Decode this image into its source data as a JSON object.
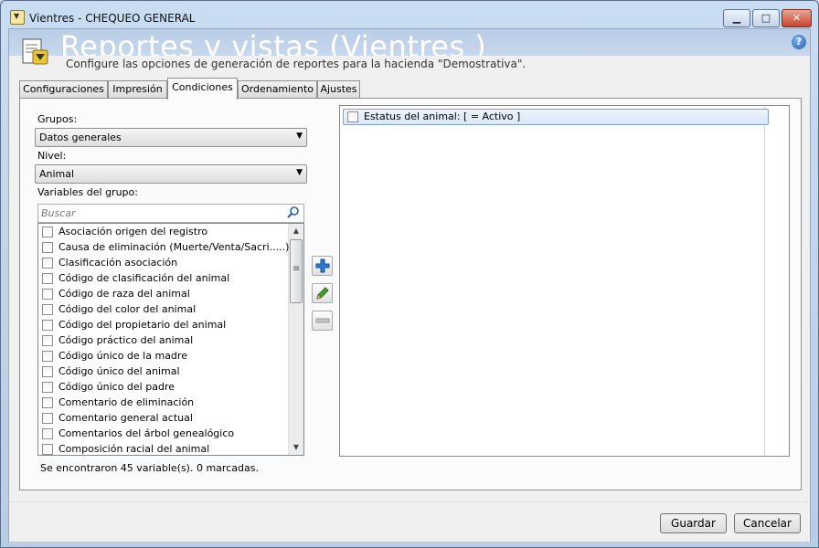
{
  "window": {
    "title": "Vientres  - CHEQUEO GENERAL"
  },
  "header": {
    "title": "Reportes y vistas (Vientres )",
    "subtitle": "Configure las opciones de generación de reportes para la hacienda \"Demostrativa\".",
    "help_glyph": "?"
  },
  "tabs": [
    {
      "label": "Configuraciones"
    },
    {
      "label": "Impresión"
    },
    {
      "label": "Condiciones"
    },
    {
      "label": "Ordenamiento"
    },
    {
      "label": "Ajustes"
    }
  ],
  "left_panel": {
    "grupos_label": "Grupos:",
    "grupos_value": "Datos generales",
    "nivel_label": "Nivel:",
    "nivel_value": "Animal",
    "variables_label": "Variables del grupo:",
    "search_placeholder": "Buscar",
    "variables": [
      "Asociación origen del registro",
      "Causa de eliminación (Muerte/Venta/Sacri.....)",
      "Clasificación asociación",
      "Código de clasificación del animal",
      "Código de raza del animal",
      "Código del color del animal",
      "Código del propietario del animal",
      "Código práctico del animal",
      "Código único de la madre",
      "Código único del animal",
      "Código único del padre",
      "Comentario de eliminación",
      "Comentario general actual",
      "Comentarios del árbol genealógico",
      "Composición racial del animal"
    ],
    "count_text": "Se encontraron 45 variable(s). 0 marcadas."
  },
  "conditions": [
    {
      "label": "Estatus del animal: [ = Activo ]"
    }
  ],
  "footer": {
    "save_label": "Guardar",
    "cancel_label": "Cancelar"
  },
  "icons": {
    "add": "plus-icon",
    "edit": "pencil-icon",
    "remove": "minus-icon",
    "search": "search-icon",
    "help": "help-icon",
    "app": "app-icon",
    "report": "report-icon"
  },
  "colors": {
    "titlebar": "#c9dcf2",
    "selection": "#d9e7f8",
    "add_icon": "#2a7ad8",
    "edit_icon": "#4aa02c"
  }
}
